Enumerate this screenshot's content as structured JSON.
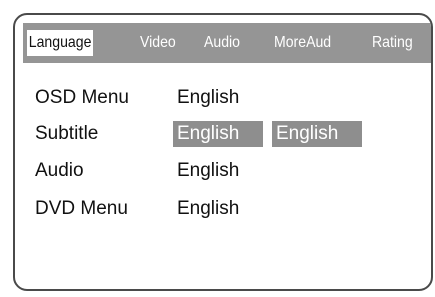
{
  "tabs": [
    {
      "label": "Language",
      "active": true
    },
    {
      "label": "Video",
      "active": false
    },
    {
      "label": "Audio",
      "active": false
    },
    {
      "label": "MoreAud",
      "active": false
    },
    {
      "label": "Rating",
      "active": false
    }
  ],
  "settings": [
    {
      "label": "OSD Menu",
      "values": [
        "English"
      ]
    },
    {
      "label": "Subtitle",
      "values": [
        "English",
        "English"
      ]
    },
    {
      "label": "Audio",
      "values": [
        "English"
      ]
    },
    {
      "label": "DVD Menu",
      "values": [
        "English"
      ]
    }
  ],
  "colors": {
    "tab_bar": "#959595",
    "highlight": "#8e8e8e",
    "border": "#4a4a4a"
  }
}
